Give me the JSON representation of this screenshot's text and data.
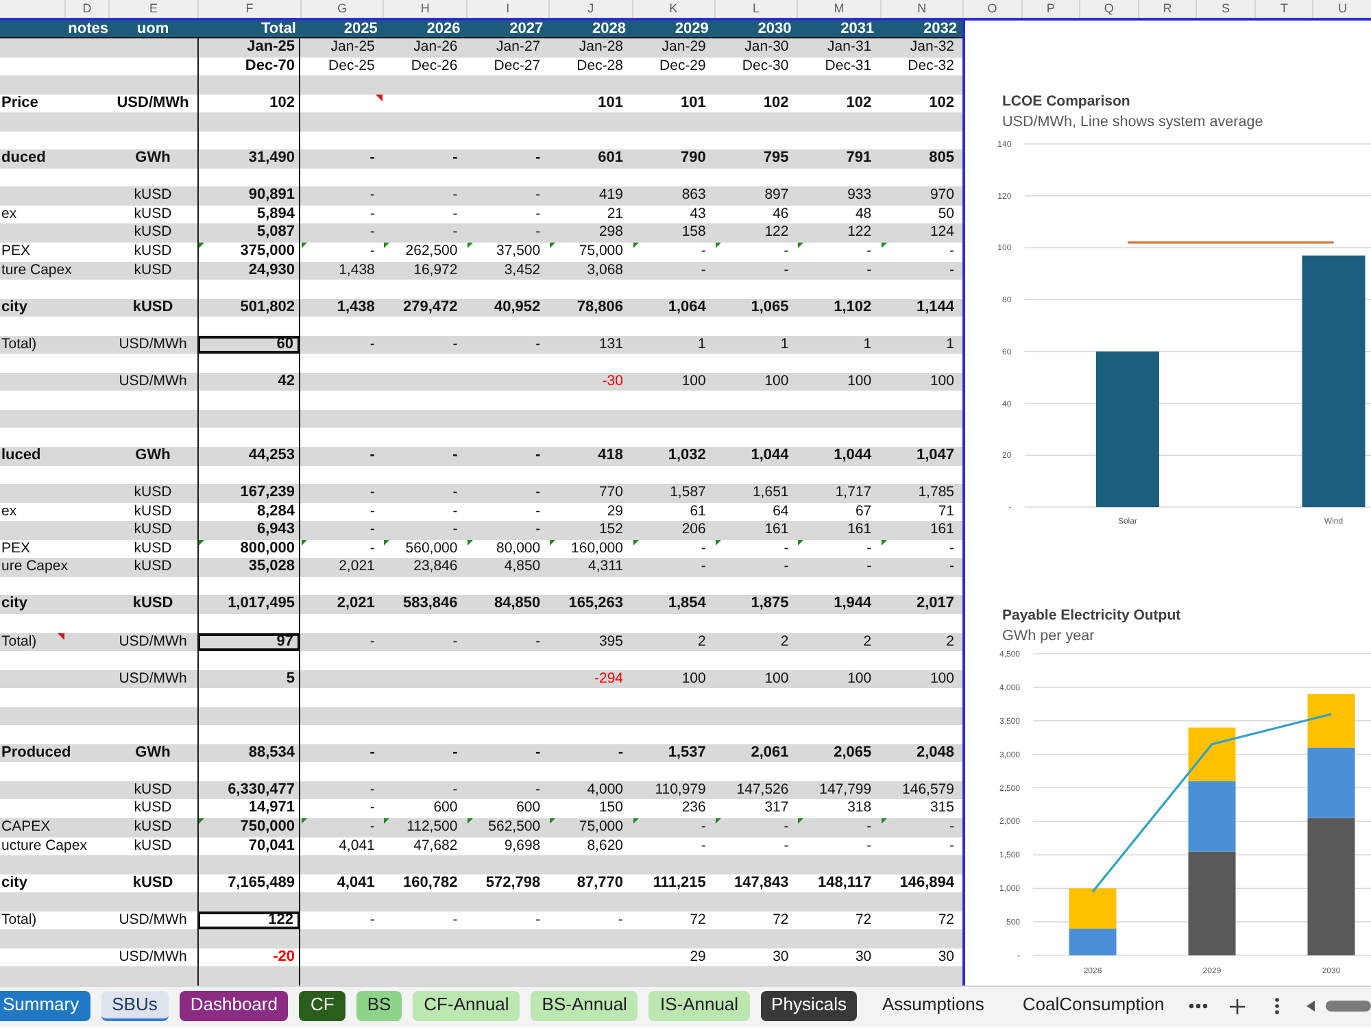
{
  "column_letters": [
    "D",
    "E",
    "F",
    "G",
    "H",
    "I",
    "J",
    "K",
    "L",
    "M",
    "N",
    "O",
    "P",
    "Q",
    "R",
    "S",
    "T",
    "U"
  ],
  "table": {
    "header": {
      "notes": "notes",
      "uom": "uom",
      "total": "Total",
      "years": [
        "2025",
        "2026",
        "2027",
        "2028",
        "2029",
        "2030",
        "2031",
        "2032"
      ]
    },
    "rows": [
      {
        "kind": "period",
        "shaded": true,
        "total": "Jan-25",
        "values": [
          "Jan-25",
          "Jan-26",
          "Jan-27",
          "Jan-28",
          "Jan-29",
          "Jan-30",
          "Jan-31",
          "Jan-32"
        ]
      },
      {
        "kind": "period",
        "shaded": false,
        "total": "Dec-70",
        "values": [
          "Dec-25",
          "Dec-26",
          "Dec-27",
          "Dec-28",
          "Dec-29",
          "Dec-30",
          "Dec-31",
          "Dec-32"
        ]
      },
      {
        "kind": "blank",
        "shaded": true
      },
      {
        "kind": "subtotal",
        "shaded": false,
        "label": "Price",
        "uom": "USD/MWh",
        "total": "102",
        "lead": [
          {
            "comment": true
          }
        ],
        "values": [
          "101",
          "101",
          "102",
          "102",
          "102"
        ]
      },
      {
        "kind": "blank",
        "shaded": true
      },
      {
        "kind": "blank",
        "shaded": false
      },
      {
        "kind": "subtotal",
        "shaded": true,
        "label": "duced",
        "uom": "GWh",
        "total": "31,490",
        "values": [
          "-",
          "-",
          "-",
          "601",
          "790",
          "795",
          "791",
          "805"
        ]
      },
      {
        "kind": "blank",
        "shaded": false
      },
      {
        "kind": "item",
        "shaded": true,
        "uom": "kUSD",
        "total": "90,891",
        "values": [
          "-",
          "-",
          "-",
          "419",
          "863",
          "897",
          "933",
          "970"
        ]
      },
      {
        "kind": "item",
        "shaded": false,
        "label": "ex",
        "uom": "kUSD",
        "total": "5,894",
        "values": [
          "-",
          "-",
          "-",
          "21",
          "43",
          "46",
          "48",
          "50"
        ]
      },
      {
        "kind": "item",
        "shaded": true,
        "uom": "kUSD",
        "total": "5,087",
        "values": [
          "-",
          "-",
          "-",
          "298",
          "158",
          "122",
          "122",
          "124"
        ]
      },
      {
        "kind": "flagged",
        "shaded": false,
        "label": "PEX",
        "uom": "kUSD",
        "total": "375,000",
        "values": [
          "-",
          "262,500",
          "37,500",
          "75,000",
          "-",
          "-",
          "-",
          "-"
        ]
      },
      {
        "kind": "item",
        "shaded": true,
        "label": "ture Capex",
        "uom": "kUSD",
        "total": "24,930",
        "values": [
          "1,438",
          "16,972",
          "3,452",
          "3,068",
          "-",
          "-",
          "-",
          "-"
        ]
      },
      {
        "kind": "blank",
        "shaded": false
      },
      {
        "kind": "subtotal",
        "shaded": true,
        "label": "city",
        "uom": "kUSD",
        "total": "501,802",
        "values": [
          "1,438",
          "279,472",
          "40,952",
          "78,806",
          "1,064",
          "1,065",
          "1,102",
          "1,144"
        ]
      },
      {
        "kind": "blank",
        "shaded": false
      },
      {
        "kind": "result",
        "shaded": true,
        "label": "Total)",
        "uom": "USD/MWh",
        "total": "60",
        "values": [
          "-",
          "-",
          "-",
          "131",
          "1",
          "1",
          "1",
          "1"
        ]
      },
      {
        "kind": "blank",
        "shaded": false
      },
      {
        "kind": "item",
        "shaded": true,
        "uom": "USD/MWh",
        "total": "42",
        "values": [
          {
            "text": "-30",
            "color": "#ff0000"
          },
          "100",
          "100",
          "100",
          "100"
        ]
      },
      {
        "kind": "blank",
        "shaded": false
      },
      {
        "kind": "blank",
        "shaded": true
      },
      {
        "kind": "blank",
        "shaded": false
      },
      {
        "kind": "subtotal",
        "shaded": true,
        "label": "luced",
        "uom": "GWh",
        "total": "44,253",
        "values": [
          "-",
          "-",
          "-",
          "418",
          "1,032",
          "1,044",
          "1,044",
          "1,047"
        ]
      },
      {
        "kind": "blank",
        "shaded": false
      },
      {
        "kind": "item",
        "shaded": true,
        "uom": "kUSD",
        "total": "167,239",
        "values": [
          "-",
          "-",
          "-",
          "770",
          "1,587",
          "1,651",
          "1,717",
          "1,785"
        ]
      },
      {
        "kind": "item",
        "shaded": false,
        "label": "ex",
        "uom": "kUSD",
        "total": "8,284",
        "values": [
          "-",
          "-",
          "-",
          "29",
          "61",
          "64",
          "67",
          "71"
        ]
      },
      {
        "kind": "item",
        "shaded": true,
        "uom": "kUSD",
        "total": "6,943",
        "values": [
          "-",
          "-",
          "-",
          "152",
          "206",
          "161",
          "161",
          "161"
        ]
      },
      {
        "kind": "flagged",
        "shaded": false,
        "label": "PEX",
        "uom": "kUSD",
        "total": "800,000",
        "values": [
          "-",
          "560,000",
          "80,000",
          "160,000",
          "-",
          "-",
          "-",
          "-"
        ]
      },
      {
        "kind": "item",
        "shaded": true,
        "label": "ure Capex",
        "uom": "kUSD",
        "total": "35,028",
        "values": [
          "2,021",
          "23,846",
          "4,850",
          "4,311",
          "-",
          "-",
          "-",
          "-"
        ]
      },
      {
        "kind": "blank",
        "shaded": false
      },
      {
        "kind": "subtotal",
        "shaded": true,
        "label": "city",
        "uom": "kUSD",
        "total": "1,017,495",
        "values": [
          "2,021",
          "583,846",
          "84,850",
          "165,263",
          "1,854",
          "1,875",
          "1,944",
          "2,017"
        ]
      },
      {
        "kind": "blank",
        "shaded": false
      },
      {
        "kind": "result",
        "shaded": true,
        "label": {
          "text": "Total)",
          "comment": true
        },
        "uom": "USD/MWh",
        "total": "97",
        "values": [
          "-",
          "-",
          "-",
          "395",
          "2",
          "2",
          "2",
          "2"
        ]
      },
      {
        "kind": "blank",
        "shaded": false
      },
      {
        "kind": "item",
        "shaded": true,
        "uom": "USD/MWh",
        "total": "5",
        "values": [
          {
            "text": "-294",
            "color": "#ff0000"
          },
          "100",
          "100",
          "100",
          "100"
        ]
      },
      {
        "kind": "blank",
        "shaded": false
      },
      {
        "kind": "blank",
        "shaded": true
      },
      {
        "kind": "blank",
        "shaded": false
      },
      {
        "kind": "subtotal",
        "shaded": true,
        "label": "Produced",
        "uom": "GWh",
        "total": "88,534",
        "values": [
          "-",
          "-",
          "-",
          "-",
          "1,537",
          "2,061",
          "2,065",
          "2,048"
        ]
      },
      {
        "kind": "blank",
        "shaded": false
      },
      {
        "kind": "item",
        "shaded": true,
        "uom": "kUSD",
        "total": "6,330,477",
        "values": [
          "-",
          "-",
          "-",
          "4,000",
          "110,979",
          "147,526",
          "147,799",
          "146,579"
        ]
      },
      {
        "kind": "item",
        "shaded": false,
        "uom": "kUSD",
        "total": "14,971",
        "values": [
          "-",
          "600",
          "600",
          "150",
          "236",
          "317",
          "318",
          "315"
        ]
      },
      {
        "kind": "flagged",
        "shaded": true,
        "label": "CAPEX",
        "uom": "kUSD",
        "total": "750,000",
        "values": [
          "-",
          "112,500",
          "562,500",
          "75,000",
          "-",
          "-",
          "-",
          "-"
        ]
      },
      {
        "kind": "item",
        "shaded": false,
        "label": "ucture Capex",
        "uom": "kUSD",
        "total": "70,041",
        "values": [
          "4,041",
          "47,682",
          "9,698",
          "8,620",
          "-",
          "-",
          "-",
          "-"
        ]
      },
      {
        "kind": "blank",
        "shaded": true
      },
      {
        "kind": "subtotal",
        "shaded": false,
        "label": "city",
        "uom": "kUSD",
        "total": "7,165,489",
        "values": [
          "4,041",
          "160,782",
          "572,798",
          "87,770",
          "111,215",
          "147,843",
          "148,117",
          "146,894"
        ]
      },
      {
        "kind": "blank",
        "shaded": true
      },
      {
        "kind": "result",
        "shaded": false,
        "label": "Total)",
        "uom": "USD/MWh",
        "total": "122",
        "values": [
          "-",
          "-",
          "-",
          "-",
          "72",
          "72",
          "72",
          "72"
        ]
      },
      {
        "kind": "blank",
        "shaded": true
      },
      {
        "kind": "item",
        "shaded": false,
        "uom": "USD/MWh",
        "total": {
          "text": "-20",
          "color": "#ff0000"
        },
        "values": [
          "29",
          "30",
          "30",
          "30"
        ]
      },
      {
        "kind": "blank",
        "shaded": true
      }
    ]
  },
  "chart_panel": [
    {
      "chart_data": [
        {
          "type": "bar",
          "title": "LCOE Comparison",
          "subtitle": "USD/MWh, Line shows system average",
          "categories": [
            "Solar",
            "Wind"
          ],
          "series": [
            {
              "type": "bar",
              "color": "#1b5e80",
              "values": [
                60,
                97
              ]
            },
            {
              "type": "line",
              "color": "#d5773b",
              "values": [
                102,
                102
              ]
            }
          ],
          "ylim": [
            0,
            140
          ],
          "yticks": [
            {
              "value": 0,
              "label": "-"
            },
            20,
            40,
            60,
            80,
            100,
            120,
            140
          ],
          "grid": true
        }
      ]
    },
    {
      "chart_data": [
        {
          "type": "bar",
          "stacked": true,
          "title": "Payable Electricity Output",
          "subtitle": "GWh per year",
          "categories": [
            "2028",
            "2029",
            "2030"
          ],
          "series": [
            {
              "color": "#595959",
              "values": [
                0,
                1550,
                2050
              ]
            },
            {
              "color": "#4a90d9",
              "values": [
                400,
                1050,
                1050
              ]
            },
            {
              "color": "#ffc000",
              "values": [
                600,
                800,
                800
              ]
            },
            {
              "type": "line",
              "color": "#2fa3c6",
              "values": [
                950,
                3150,
                3600
              ]
            }
          ],
          "ylim": [
            0,
            4500
          ],
          "yticks": [
            {
              "value": 0,
              "label": "-"
            },
            {
              "value": 500,
              "label": "500"
            },
            {
              "value": 1000,
              "label": "1,000"
            },
            {
              "value": 1500,
              "label": "1,500"
            },
            {
              "value": 2000,
              "label": "2,000"
            },
            {
              "value": 2500,
              "label": "2,500"
            },
            {
              "value": 3000,
              "label": "3,000"
            },
            {
              "value": 3500,
              "label": "3,500"
            },
            {
              "value": 4000,
              "label": "4,000"
            },
            {
              "value": 4500,
              "label": "4,500"
            }
          ],
          "grid": true
        }
      ]
    }
  ],
  "sheet_tabs": [
    {
      "label": "Summary",
      "color": "#1f78c4",
      "selected": false
    },
    {
      "label": "SBUs",
      "color": "#3b7ccc",
      "selected": true
    },
    {
      "label": "Dashboard",
      "color": "#8b2b84",
      "selected": false
    },
    {
      "label": "CF",
      "color": "#2b5e1d",
      "selected": false
    },
    {
      "label": "BS",
      "color": "#8ed488",
      "selected": false
    },
    {
      "label": "CF-Annual",
      "color": "#bce7b1",
      "selected": false
    },
    {
      "label": "BS-Annual",
      "color": "#bce7b1",
      "selected": false
    },
    {
      "label": "IS-Annual",
      "color": "#bce7b1",
      "selected": false
    },
    {
      "label": "Physicals",
      "color": "#383838",
      "selected": false
    },
    {
      "label": "Assumptions",
      "selected": false
    },
    {
      "label": "CoalConsumption",
      "selected": false
    }
  ]
}
